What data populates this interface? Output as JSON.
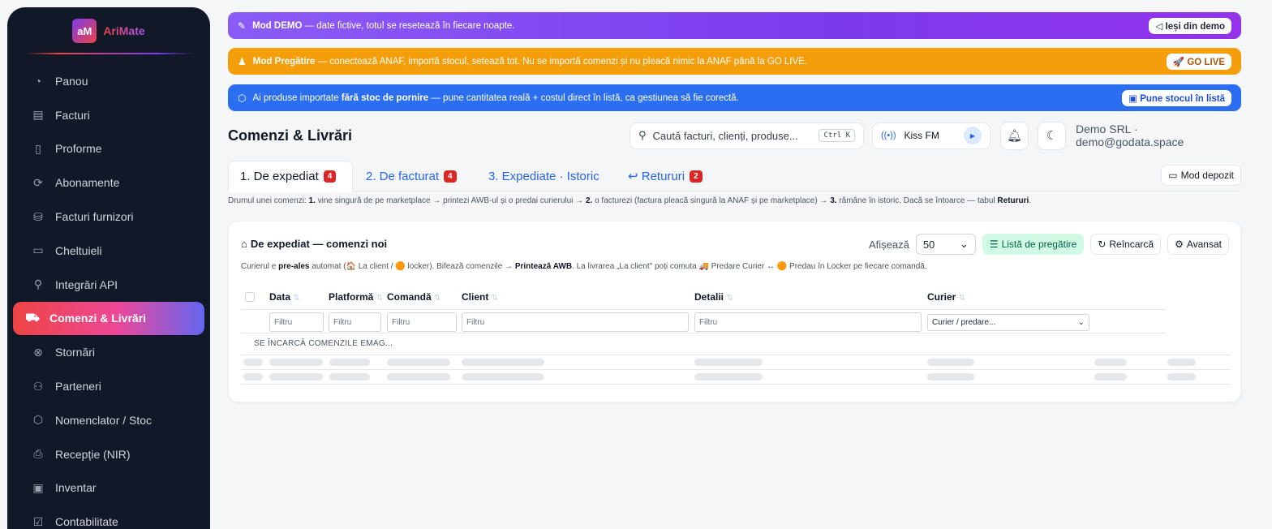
{
  "brand": {
    "logo_text": "aM",
    "name": "AriMate"
  },
  "sidebar": {
    "items": [
      {
        "label": "Panou",
        "icon": "gauge-icon",
        "glyph": "◔"
      },
      {
        "label": "Facturi",
        "icon": "invoice-icon",
        "glyph": "▤"
      },
      {
        "label": "Proforme",
        "icon": "document-icon",
        "glyph": "▯"
      },
      {
        "label": "Abonamente",
        "icon": "refresh-icon",
        "glyph": "⟳"
      },
      {
        "label": "Facturi furnizori",
        "icon": "supplier-invoice-icon",
        "glyph": "⛁"
      },
      {
        "label": "Cheltuieli",
        "icon": "wallet-icon",
        "glyph": "▭"
      },
      {
        "label": "Integrări API",
        "icon": "plug-icon",
        "glyph": "⚲"
      },
      {
        "label": "Comenzi & Livrări",
        "icon": "truck-icon",
        "glyph": "⛟",
        "active": true
      },
      {
        "label": "Stornări",
        "icon": "cancel-circle-icon",
        "glyph": "⊗"
      },
      {
        "label": "Parteneri",
        "icon": "users-icon",
        "glyph": "⚇"
      },
      {
        "label": "Nomenclator / Stoc",
        "icon": "box-icon",
        "glyph": "⬡"
      },
      {
        "label": "Recepție (NIR)",
        "icon": "receipt-icon",
        "glyph": "⎙"
      },
      {
        "label": "Inventar",
        "icon": "clipboard-icon",
        "glyph": "▣"
      },
      {
        "label": "Contabilitate",
        "icon": "ledger-icon",
        "glyph": "☑"
      }
    ]
  },
  "banners": {
    "demo": {
      "icon": "wand-icon",
      "glyph": "✎",
      "bold": "Mod DEMO",
      "text": " — date fictive, totul se resetează în fiecare noapte.",
      "button": "◁ Ieși din demo",
      "color": "#7c3aed"
    },
    "prep": {
      "icon": "flask-icon",
      "glyph": "♟",
      "bold": "Mod Pregătire",
      "text": " — conectează ANAF, importă stocul, setează tot. Nu se importă comenzi și nu pleacă nimic la ANAF până la GO LIVE.",
      "button": "🚀 GO LIVE",
      "color": "#f59e0b"
    },
    "stock": {
      "icon": "box-icon",
      "glyph": "⬡",
      "pre": "Ai produse importate ",
      "bold": "fără stoc de pornire",
      "text": " — pune cantitatea reală + costul direct în listă, ca gestiunea să fie corectă.",
      "button": "▣ Pune stocul în listă",
      "color": "#2b6ef0"
    }
  },
  "header": {
    "title": "Comenzi & Livrări",
    "search_placeholder": "Caută facturi, clienți, produse...",
    "search_shortcut": "Ctrl K",
    "radio_station": "Kiss FM",
    "account": "Demo SRL · demo@godata.space"
  },
  "tabs": [
    {
      "label": "1. De expediat",
      "count": "4"
    },
    {
      "label": "2. De facturat",
      "count": "4"
    },
    {
      "label": "3. Expediate · Istoric",
      "count": ""
    },
    {
      "label": "↩ Retururi",
      "count": "2"
    }
  ],
  "mod_depozit": "Mod depozit",
  "flow": {
    "p1": "Drumul unei comenzi: ",
    "s1": "1.",
    "t1": " vine singură de pe marketplace → printezi AWB-ul și o predai curierului → ",
    "s2": "2.",
    "t2": " o facturezi (factura pleacă singură la ANAF și pe marketplace) → ",
    "s3": "3.",
    "t3": " rămâne în istoric. Dacă se întoarce — tabul ",
    "s4": "Retururi",
    "t4": "."
  },
  "card": {
    "title": "De expediat — comenzi noi",
    "show_label": "Afișează",
    "page_size": "50",
    "btn_list": "Listă de pregătire",
    "btn_reload": "Reîncarcă",
    "btn_advanced": "Avansat",
    "desc": {
      "a": "Curierul e ",
      "b": "pre-ales",
      "c": " automat (🏠 La client / 🟠 locker). Bifează comenzile → ",
      "d": "Printează AWB",
      "e": ". La livrarea „La client\" poți comuta 🚚 Predare Curier ↔ 🟠 Predau în Locker pe fiecare comandă."
    },
    "columns": [
      "Data",
      "Platformă",
      "Comandă",
      "Client",
      "Detalii",
      "Curier"
    ],
    "filter_placeholder": "Filtru",
    "courier_placeholder": "Curier / predare...",
    "loading": "SE ÎNCARCĂ COMENZILE EMAG..."
  }
}
